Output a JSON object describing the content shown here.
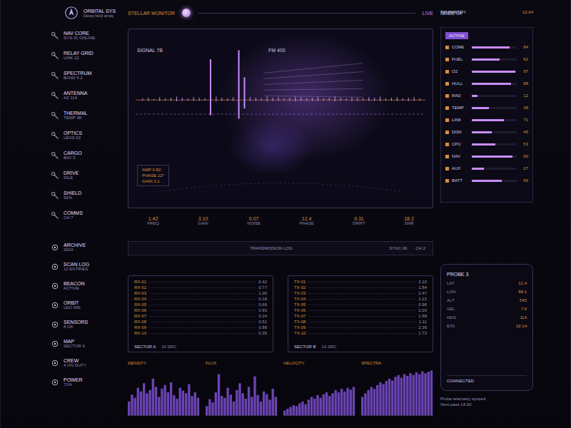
{
  "header": {
    "brand": "ORBITAL SYS",
    "subtitle": "Deep field array",
    "title": "STELLAR MONITOR",
    "mode": "LIVE",
    "status": "NODE 04"
  },
  "sidebar_top": [
    {
      "label": "NAV CORE",
      "sub": "SYS 01 ONLINE"
    },
    {
      "label": "RELAY GRID",
      "sub": "LINK 12"
    },
    {
      "label": "SPECTRUM",
      "sub": "BAND 4.2"
    },
    {
      "label": "ANTENNA",
      "sub": "AZ 114"
    },
    {
      "label": "THERMAL",
      "sub": "TEMP 38"
    },
    {
      "label": "OPTICS",
      "sub": "LENS 02"
    },
    {
      "label": "CARGO",
      "sub": "BAY 3"
    },
    {
      "label": "DRIVE",
      "sub": "IDLE"
    },
    {
      "label": "SHIELD",
      "sub": "92%"
    },
    {
      "label": "COMMS",
      "sub": "CH 7"
    }
  ],
  "sidebar_bottom": [
    {
      "label": "ARCHIVE",
      "sub": "2024"
    },
    {
      "label": "SCAN LOG",
      "sub": "12 ENTRIES"
    },
    {
      "label": "BEACON",
      "sub": "ACTIVE"
    },
    {
      "label": "ORBIT",
      "sub": "LEO 540"
    },
    {
      "label": "SENSORS",
      "sub": "8 OK"
    },
    {
      "label": "MAP",
      "sub": "SECTOR 9"
    },
    {
      "label": "CREW",
      "sub": "4 ON DUTY"
    },
    {
      "label": "POWER",
      "sub": "71%"
    }
  ],
  "chart": {
    "title": "SIGNAL 7B",
    "band": "FM 400",
    "signal": [
      3,
      4,
      2,
      5,
      3,
      4,
      6,
      4,
      3,
      5,
      4,
      3,
      72,
      6,
      4,
      3,
      5,
      88,
      40,
      5,
      4,
      3,
      6,
      4,
      5,
      3,
      4,
      6,
      5,
      3,
      4,
      5,
      3,
      4,
      6,
      4,
      3,
      5,
      4,
      3,
      5,
      4,
      6,
      3,
      4,
      5,
      3,
      4,
      5,
      3
    ],
    "readout": [
      "AMP 0.82",
      "PHASE 12°",
      "GAIN 3.1"
    ]
  },
  "stats": [
    {
      "value": "1.42",
      "label": "FREQ"
    },
    {
      "value": "3.10",
      "label": "GAIN"
    },
    {
      "value": "0.07",
      "label": "NOISE"
    },
    {
      "value": "12.4",
      "label": "PHASE"
    },
    {
      "value": "0.31",
      "label": "DRIFT"
    },
    {
      "value": "18.2",
      "label": "SNR"
    }
  ],
  "strip": {
    "title": "TRANSMISSION LOG",
    "sync": "SYNC 06",
    "channel": "CH 2"
  },
  "tables": [
    {
      "title": "SECTOR A",
      "note": "10 SRC",
      "rows": [
        {
          "key": "RX-01",
          "value": "0.42"
        },
        {
          "key": "RX-02",
          "value": "0.77"
        },
        {
          "key": "RX-03",
          "value": "1.05"
        },
        {
          "key": "RX-04",
          "value": "0.18"
        },
        {
          "key": "RX-05",
          "value": "0.66"
        },
        {
          "key": "RX-06",
          "value": "0.93"
        },
        {
          "key": "RX-07",
          "value": "0.24"
        },
        {
          "key": "RX-08",
          "value": "0.51"
        },
        {
          "key": "RX-09",
          "value": "0.88"
        },
        {
          "key": "RX-10",
          "value": "0.35"
        }
      ]
    },
    {
      "title": "SECTOR B",
      "note": "10 SRC",
      "rows": [
        {
          "key": "TX-01",
          "value": "2.10"
        },
        {
          "key": "TX-02",
          "value": "1.84"
        },
        {
          "key": "TX-03",
          "value": "2.47"
        },
        {
          "key": "TX-04",
          "value": "1.22"
        },
        {
          "key": "TX-05",
          "value": "0.96"
        },
        {
          "key": "TX-06",
          "value": "2.03"
        },
        {
          "key": "TX-07",
          "value": "1.58"
        },
        {
          "key": "TX-08",
          "value": "1.11"
        },
        {
          "key": "TX-09",
          "value": "2.36"
        },
        {
          "key": "TX-10",
          "value": "1.73"
        }
      ]
    }
  ],
  "telemetry": {
    "title": "TELEMETRY",
    "time": "12:04",
    "highlight": "ACTIVE",
    "rows": [
      {
        "label": "CORE",
        "value": "84",
        "level": 0.84
      },
      {
        "label": "FUEL",
        "value": "62",
        "level": 0.62
      },
      {
        "label": "O2",
        "value": "97",
        "level": 0.97
      },
      {
        "label": "HULL",
        "value": "88",
        "level": 0.88
      },
      {
        "label": "RAD",
        "value": "12",
        "level": 0.12
      },
      {
        "label": "TEMP",
        "value": "38",
        "level": 0.38
      },
      {
        "label": "LINK",
        "value": "71",
        "level": 0.71
      },
      {
        "label": "DISK",
        "value": "45",
        "level": 0.45
      },
      {
        "label": "CPU",
        "value": "53",
        "level": 0.53
      },
      {
        "label": "NAV",
        "value": "90",
        "level": 0.9
      },
      {
        "label": "AUX",
        "value": "27",
        "level": 0.27
      },
      {
        "label": "BATT",
        "value": "66",
        "level": 0.66
      }
    ]
  },
  "device": {
    "title": "PROBE 3",
    "rows": [
      {
        "label": "LAT",
        "value": "12.4"
      },
      {
        "label": "LON",
        "value": "88.1"
      },
      {
        "label": "ALT",
        "value": "540"
      },
      {
        "label": "VEL",
        "value": "7.6"
      },
      {
        "label": "HDG",
        "value": "114"
      },
      {
        "label": "ETA",
        "value": "02:14"
      }
    ],
    "status": "CONNECTED",
    "footer": [
      "Probe telemetry synced",
      "Next pass 14:20"
    ]
  },
  "charts": [
    {
      "title": "DENSITY",
      "values": [
        30,
        45,
        38,
        60,
        52,
        70,
        48,
        55,
        80,
        62,
        40,
        58,
        66,
        50,
        72,
        44,
        36,
        60,
        54,
        48,
        68,
        42,
        50,
        38
      ]
    },
    {
      "title": "FLUX",
      "values": [
        20,
        35,
        28,
        50,
        90,
        42,
        38,
        60,
        45,
        30,
        55,
        70,
        48,
        36,
        62,
        40,
        85,
        44,
        30,
        52,
        46,
        34,
        58,
        40
      ]
    },
    {
      "title": "VELOCITY",
      "values": [
        10,
        14,
        18,
        22,
        20,
        26,
        30,
        24,
        34,
        40,
        36,
        44,
        38,
        46,
        50,
        42,
        48,
        55,
        50,
        58,
        52,
        60,
        56,
        62
      ]
    },
    {
      "title": "SPECTRA",
      "values": [
        40,
        48,
        55,
        62,
        58,
        66,
        72,
        68,
        75,
        80,
        76,
        84,
        88,
        82,
        90,
        86,
        92,
        88,
        94,
        90,
        96,
        92,
        95,
        98
      ]
    }
  ]
}
